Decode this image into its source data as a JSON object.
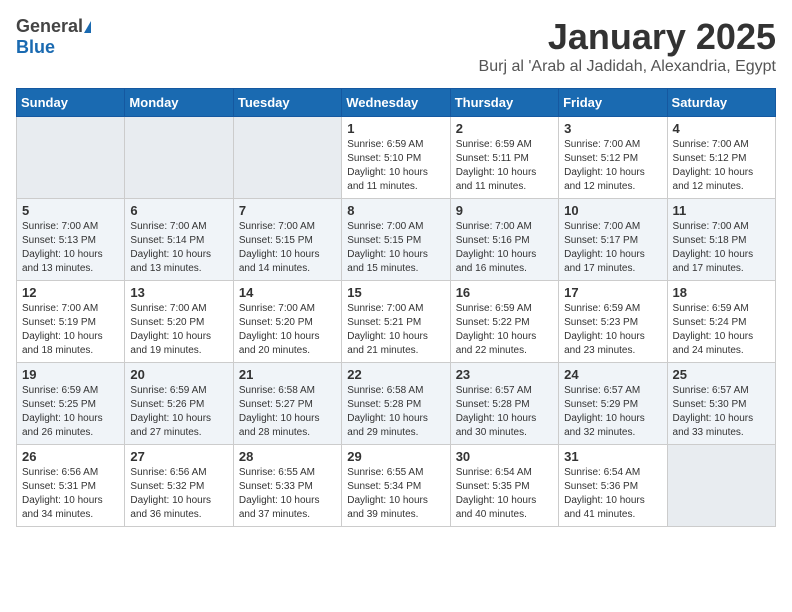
{
  "logo": {
    "general": "General",
    "blue": "Blue"
  },
  "title": {
    "month": "January 2025",
    "location": "Burj al 'Arab al Jadidah, Alexandria, Egypt"
  },
  "days_of_week": [
    "Sunday",
    "Monday",
    "Tuesday",
    "Wednesday",
    "Thursday",
    "Friday",
    "Saturday"
  ],
  "weeks": [
    [
      {
        "day": "",
        "info": ""
      },
      {
        "day": "",
        "info": ""
      },
      {
        "day": "",
        "info": ""
      },
      {
        "day": "1",
        "info": "Sunrise: 6:59 AM\nSunset: 5:10 PM\nDaylight: 10 hours\nand 11 minutes."
      },
      {
        "day": "2",
        "info": "Sunrise: 6:59 AM\nSunset: 5:11 PM\nDaylight: 10 hours\nand 11 minutes."
      },
      {
        "day": "3",
        "info": "Sunrise: 7:00 AM\nSunset: 5:12 PM\nDaylight: 10 hours\nand 12 minutes."
      },
      {
        "day": "4",
        "info": "Sunrise: 7:00 AM\nSunset: 5:12 PM\nDaylight: 10 hours\nand 12 minutes."
      }
    ],
    [
      {
        "day": "5",
        "info": "Sunrise: 7:00 AM\nSunset: 5:13 PM\nDaylight: 10 hours\nand 13 minutes."
      },
      {
        "day": "6",
        "info": "Sunrise: 7:00 AM\nSunset: 5:14 PM\nDaylight: 10 hours\nand 13 minutes."
      },
      {
        "day": "7",
        "info": "Sunrise: 7:00 AM\nSunset: 5:15 PM\nDaylight: 10 hours\nand 14 minutes."
      },
      {
        "day": "8",
        "info": "Sunrise: 7:00 AM\nSunset: 5:15 PM\nDaylight: 10 hours\nand 15 minutes."
      },
      {
        "day": "9",
        "info": "Sunrise: 7:00 AM\nSunset: 5:16 PM\nDaylight: 10 hours\nand 16 minutes."
      },
      {
        "day": "10",
        "info": "Sunrise: 7:00 AM\nSunset: 5:17 PM\nDaylight: 10 hours\nand 17 minutes."
      },
      {
        "day": "11",
        "info": "Sunrise: 7:00 AM\nSunset: 5:18 PM\nDaylight: 10 hours\nand 17 minutes."
      }
    ],
    [
      {
        "day": "12",
        "info": "Sunrise: 7:00 AM\nSunset: 5:19 PM\nDaylight: 10 hours\nand 18 minutes."
      },
      {
        "day": "13",
        "info": "Sunrise: 7:00 AM\nSunset: 5:20 PM\nDaylight: 10 hours\nand 19 minutes."
      },
      {
        "day": "14",
        "info": "Sunrise: 7:00 AM\nSunset: 5:20 PM\nDaylight: 10 hours\nand 20 minutes."
      },
      {
        "day": "15",
        "info": "Sunrise: 7:00 AM\nSunset: 5:21 PM\nDaylight: 10 hours\nand 21 minutes."
      },
      {
        "day": "16",
        "info": "Sunrise: 6:59 AM\nSunset: 5:22 PM\nDaylight: 10 hours\nand 22 minutes."
      },
      {
        "day": "17",
        "info": "Sunrise: 6:59 AM\nSunset: 5:23 PM\nDaylight: 10 hours\nand 23 minutes."
      },
      {
        "day": "18",
        "info": "Sunrise: 6:59 AM\nSunset: 5:24 PM\nDaylight: 10 hours\nand 24 minutes."
      }
    ],
    [
      {
        "day": "19",
        "info": "Sunrise: 6:59 AM\nSunset: 5:25 PM\nDaylight: 10 hours\nand 26 minutes."
      },
      {
        "day": "20",
        "info": "Sunrise: 6:59 AM\nSunset: 5:26 PM\nDaylight: 10 hours\nand 27 minutes."
      },
      {
        "day": "21",
        "info": "Sunrise: 6:58 AM\nSunset: 5:27 PM\nDaylight: 10 hours\nand 28 minutes."
      },
      {
        "day": "22",
        "info": "Sunrise: 6:58 AM\nSunset: 5:28 PM\nDaylight: 10 hours\nand 29 minutes."
      },
      {
        "day": "23",
        "info": "Sunrise: 6:57 AM\nSunset: 5:28 PM\nDaylight: 10 hours\nand 30 minutes."
      },
      {
        "day": "24",
        "info": "Sunrise: 6:57 AM\nSunset: 5:29 PM\nDaylight: 10 hours\nand 32 minutes."
      },
      {
        "day": "25",
        "info": "Sunrise: 6:57 AM\nSunset: 5:30 PM\nDaylight: 10 hours\nand 33 minutes."
      }
    ],
    [
      {
        "day": "26",
        "info": "Sunrise: 6:56 AM\nSunset: 5:31 PM\nDaylight: 10 hours\nand 34 minutes."
      },
      {
        "day": "27",
        "info": "Sunrise: 6:56 AM\nSunset: 5:32 PM\nDaylight: 10 hours\nand 36 minutes."
      },
      {
        "day": "28",
        "info": "Sunrise: 6:55 AM\nSunset: 5:33 PM\nDaylight: 10 hours\nand 37 minutes."
      },
      {
        "day": "29",
        "info": "Sunrise: 6:55 AM\nSunset: 5:34 PM\nDaylight: 10 hours\nand 39 minutes."
      },
      {
        "day": "30",
        "info": "Sunrise: 6:54 AM\nSunset: 5:35 PM\nDaylight: 10 hours\nand 40 minutes."
      },
      {
        "day": "31",
        "info": "Sunrise: 6:54 AM\nSunset: 5:36 PM\nDaylight: 10 hours\nand 41 minutes."
      },
      {
        "day": "",
        "info": ""
      }
    ]
  ]
}
